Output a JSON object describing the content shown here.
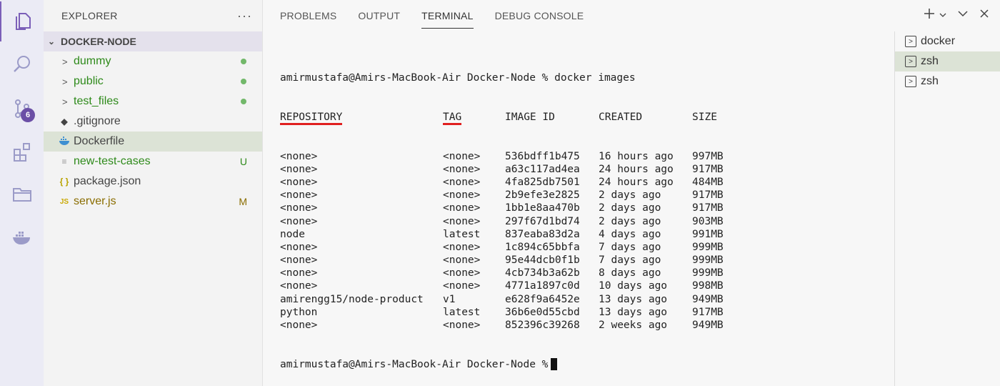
{
  "sidebar": {
    "title": "EXPLORER",
    "more": "···",
    "folder": "DOCKER-NODE",
    "items": [
      {
        "label": "dummy",
        "twist": ">",
        "color": "green",
        "dot": true
      },
      {
        "label": "public",
        "twist": ">",
        "color": "green",
        "dot": true
      },
      {
        "label": "test_files",
        "twist": ">",
        "color": "green",
        "dot": true
      },
      {
        "label": ".gitignore",
        "icon": "git-icon",
        "color": "gray"
      },
      {
        "label": "Dockerfile",
        "icon": "docker-icon",
        "color": "gray",
        "selected": true
      },
      {
        "label": "new-test-cases",
        "icon": "lines-icon",
        "color": "green",
        "status": "U"
      },
      {
        "label": "package.json",
        "icon": "braces-icon",
        "icon_text": "{ }",
        "color": "gray"
      },
      {
        "label": "server.js",
        "icon": "js-icon",
        "icon_text": "JS",
        "color": "olive",
        "status": "M"
      }
    ]
  },
  "activity": {
    "scm_badge": "6"
  },
  "panel": {
    "tabs": [
      "PROBLEMS",
      "OUTPUT",
      "TERMINAL",
      "DEBUG CONSOLE"
    ],
    "active_tab": "TERMINAL",
    "actions": [
      "plus-icon",
      "chevron-down-icon",
      "chevron-down-icon",
      "close-icon"
    ]
  },
  "terminal": {
    "command_line": "amirmustafa@Amirs-MacBook-Air Docker-Node % docker images",
    "headers": [
      "REPOSITORY",
      "TAG",
      "IMAGE ID",
      "CREATED",
      "SIZE"
    ],
    "rows": [
      [
        "<none>",
        "<none>",
        "536bdff1b475",
        "16 hours ago",
        "997MB"
      ],
      [
        "<none>",
        "<none>",
        "a63c117ad4ea",
        "24 hours ago",
        "917MB"
      ],
      [
        "<none>",
        "<none>",
        "4fa825db7501",
        "24 hours ago",
        "484MB"
      ],
      [
        "<none>",
        "<none>",
        "2b9efe3e2825",
        "2 days ago",
        "917MB"
      ],
      [
        "<none>",
        "<none>",
        "1bb1e8aa470b",
        "2 days ago",
        "917MB"
      ],
      [
        "<none>",
        "<none>",
        "297f67d1bd74",
        "2 days ago",
        "903MB"
      ],
      [
        "node",
        "latest",
        "837eaba83d2a",
        "4 days ago",
        "991MB"
      ],
      [
        "<none>",
        "<none>",
        "1c894c65bbfa",
        "7 days ago",
        "999MB"
      ],
      [
        "<none>",
        "<none>",
        "95e44dcb0f1b",
        "7 days ago",
        "999MB"
      ],
      [
        "<none>",
        "<none>",
        "4cb734b3a62b",
        "8 days ago",
        "999MB"
      ],
      [
        "<none>",
        "<none>",
        "4771a1897c0d",
        "10 days ago",
        "998MB"
      ],
      [
        "amirengg15/node-product",
        "v1",
        "e628f9a6452e",
        "13 days ago",
        "949MB"
      ],
      [
        "python",
        "latest",
        "36b6e0d55cbd",
        "13 days ago",
        "917MB"
      ],
      [
        "<none>",
        "<none>",
        "852396c39268",
        "2 weeks ago",
        "949MB"
      ]
    ],
    "prompt": "amirmustafa@Amirs-MacBook-Air Docker-Node %"
  },
  "terminal_list": [
    {
      "label": "docker",
      "active": false
    },
    {
      "label": "zsh",
      "active": true
    },
    {
      "label": "zsh",
      "active": false
    }
  ]
}
